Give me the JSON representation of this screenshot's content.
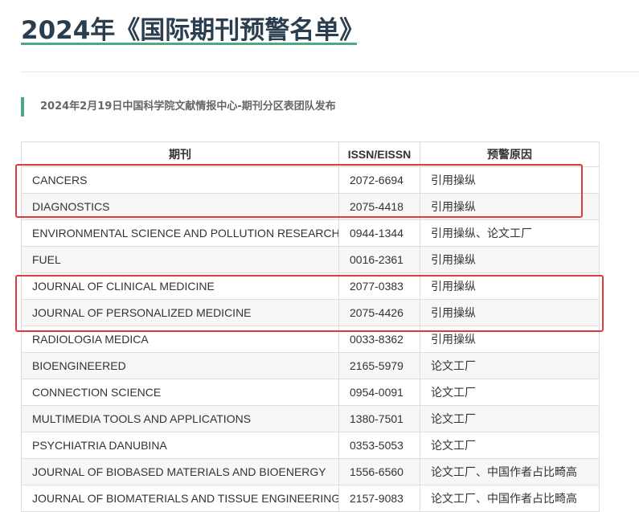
{
  "title": "2024年《国际期刊预警名单》",
  "subtitle": "2024年2月19日中国科学院文献情报中心-期刊分区表团队发布",
  "table": {
    "headers": [
      "期刊",
      "ISSN/EISSN",
      "预警原因"
    ],
    "rows": [
      {
        "journal": "CANCERS",
        "issn": "2072-6694",
        "reason": "引用操纵"
      },
      {
        "journal": "DIAGNOSTICS",
        "issn": "2075-4418",
        "reason": "引用操纵"
      },
      {
        "journal": "ENVIRONMENTAL SCIENCE AND POLLUTION RESEARCH",
        "issn": "0944-1344",
        "reason": "引用操纵、论文工厂"
      },
      {
        "journal": "FUEL",
        "issn": "0016-2361",
        "reason": "引用操纵"
      },
      {
        "journal": "JOURNAL OF CLINICAL MEDICINE",
        "issn": "2077-0383",
        "reason": "引用操纵"
      },
      {
        "journal": "JOURNAL OF PERSONALIZED MEDICINE",
        "issn": "2075-4426",
        "reason": "引用操纵"
      },
      {
        "journal": "RADIOLOGIA MEDICA",
        "issn": "0033-8362",
        "reason": "引用操纵"
      },
      {
        "journal": "BIOENGINEERED",
        "issn": "2165-5979",
        "reason": "论文工厂"
      },
      {
        "journal": "CONNECTION SCIENCE",
        "issn": "0954-0091",
        "reason": "论文工厂"
      },
      {
        "journal": "MULTIMEDIA TOOLS AND APPLICATIONS",
        "issn": "1380-7501",
        "reason": "论文工厂"
      },
      {
        "journal": "PSYCHIATRIA DANUBINA",
        "issn": "0353-5053",
        "reason": "论文工厂"
      },
      {
        "journal": "JOURNAL OF BIOBASED MATERIALS AND BIOENERGY",
        "issn": "1556-6560",
        "reason": "论文工厂、中国作者占比畸高"
      },
      {
        "journal": "JOURNAL OF BIOMATERIALS AND TISSUE ENGINEERING",
        "issn": "2157-9083",
        "reason": "论文工厂、中国作者占比畸高"
      }
    ]
  },
  "colors": {
    "accent": "#4da884",
    "highlight": "#e23a3a",
    "title": "#2b3e50"
  }
}
